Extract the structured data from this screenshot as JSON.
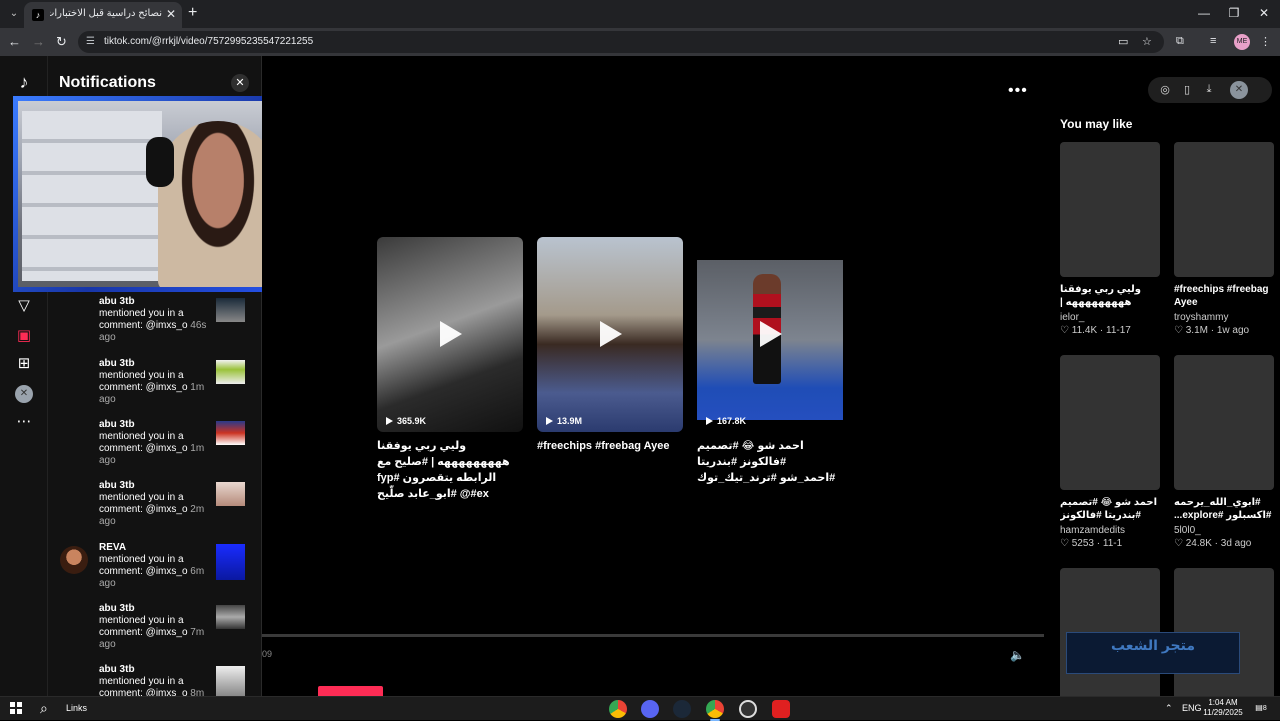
{
  "browser": {
    "tab_title": "نصائح دراسية قبل الاختبارات النهائية",
    "tab_favicon": "tiktok-icon",
    "url": "tiktok.com/@rrkjl/video/7572995235547221255",
    "profile_initials": "ME"
  },
  "notifications": {
    "title": "Notifications",
    "items": [
      {
        "name": "abu 3tb",
        "message": "mentioned you in a comment: @imxs_o",
        "time": "46s ago"
      },
      {
        "name": "abu 3tb",
        "message": "mentioned you in a comment: @imxs_o",
        "time": "1m ago"
      },
      {
        "name": "abu 3tb",
        "message": "mentioned you in a comment: @imxs_o",
        "time": "1m ago"
      },
      {
        "name": "abu 3tb",
        "message": "mentioned you in a comment: @imxs_o",
        "time": "2m ago"
      },
      {
        "name": "REVA",
        "message": "mentioned you in a comment: @imxs_o",
        "time": "6m ago"
      },
      {
        "name": "abu 3tb",
        "message": "mentioned you in a comment: @imxs_o",
        "time": "7m ago"
      },
      {
        "name": "abu 3tb",
        "message": "mentioned you in a comment: @imxs_o",
        "time": "8m ago"
      }
    ]
  },
  "videos": [
    {
      "views": "365.9K",
      "caption": "وليي ربي يوفقنا هههههههههه | #صليح مع الرابطه يتقصرون #fyp #ex@ #ابو_عابد صلّيح"
    },
    {
      "views": "13.9M",
      "caption": "#freechips #freebag Ayee"
    },
    {
      "views": "167.8K",
      "caption": "احمد شو 😂 #تصميم #فالكونز #بندريتا #احمد_شو #ترند_تيك_توك"
    }
  ],
  "player": {
    "timecode": "09"
  },
  "you_may_like": {
    "heading": "You may like",
    "cards": [
      {
        "caption": "وليي ربي يوفقنا هههههههههه | #صليح #ابو_عابد #fyp...",
        "author": "ielor_",
        "likes": "11.4K",
        "date": "11-17",
        "image": "bw-crowd"
      },
      {
        "caption": "#freechips #freebag Ayee",
        "author": "troyshammy",
        "likes": "3.1M",
        "date": "1w ago",
        "image": "boy-outdoors"
      },
      {
        "caption": "احمد شو 😂 #تصميم #بندريتا #فالكونز #احمد_شو",
        "author": "hamzamdedits",
        "likes": "5253",
        "date": "11-1",
        "image": "football-player"
      },
      {
        "caption": "#ابوي_الله_يرحمه #اكسبلور #explore...",
        "author": "5l0l0_",
        "likes": "24.8K",
        "date": "3d ago",
        "image": "old-man"
      },
      {
        "caption": "",
        "author": "",
        "likes": "",
        "date": "",
        "image": "girl"
      },
      {
        "caption": "",
        "author": "",
        "likes": "",
        "date": "",
        "image": "man"
      }
    ]
  },
  "overlay_ad": {
    "text": "متجر الشعب"
  },
  "taskbar": {
    "search_label": "Links",
    "language": "ENG",
    "time": "1:04 AM",
    "date": "11/29/2025",
    "notification_count": "8"
  },
  "colors": {
    "accent": "#fe2c55",
    "chrome_dark": "#202124",
    "panel": "#121212"
  }
}
